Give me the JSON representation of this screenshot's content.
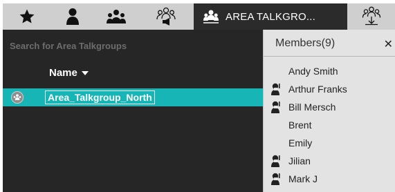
{
  "tabs": {
    "favorites_icon": "star-icon",
    "contacts_icon": "person-icon",
    "groups_icon": "group-icon",
    "talkgroup_broadcast_icon": "group-broadcast-icon",
    "active_label": "AREA TALKGROUPS",
    "active_display": "AREA TALKGRO...",
    "download_icon": "group-download-icon"
  },
  "left_panel": {
    "search_placeholder": "Search for Area Talkgroups",
    "column_header": "Name",
    "sort_icon": "sort-down-icon",
    "rows": [
      {
        "name": "Area_Talkgroup_North",
        "icon": "talkgroup-icon",
        "selected": true
      }
    ]
  },
  "members_panel": {
    "title": "Members(9)",
    "close_glyph": "✕",
    "members": [
      {
        "name": "Andy Smith",
        "has_badge": false
      },
      {
        "name": "Arthur Franks",
        "has_badge": true
      },
      {
        "name": "Bill Mersch",
        "has_badge": true
      },
      {
        "name": "Brent",
        "has_badge": false
      },
      {
        "name": "Emily",
        "has_badge": false
      },
      {
        "name": "Jilian",
        "has_badge": true
      },
      {
        "name": "Mark J",
        "has_badge": true
      }
    ]
  },
  "colors": {
    "tab_bar": "#cfcfcf",
    "active_tab": "#2b2b2b",
    "left_bg": "#262626",
    "selected_row": "#17b5b6",
    "members_bg": "#e3e3e3"
  }
}
